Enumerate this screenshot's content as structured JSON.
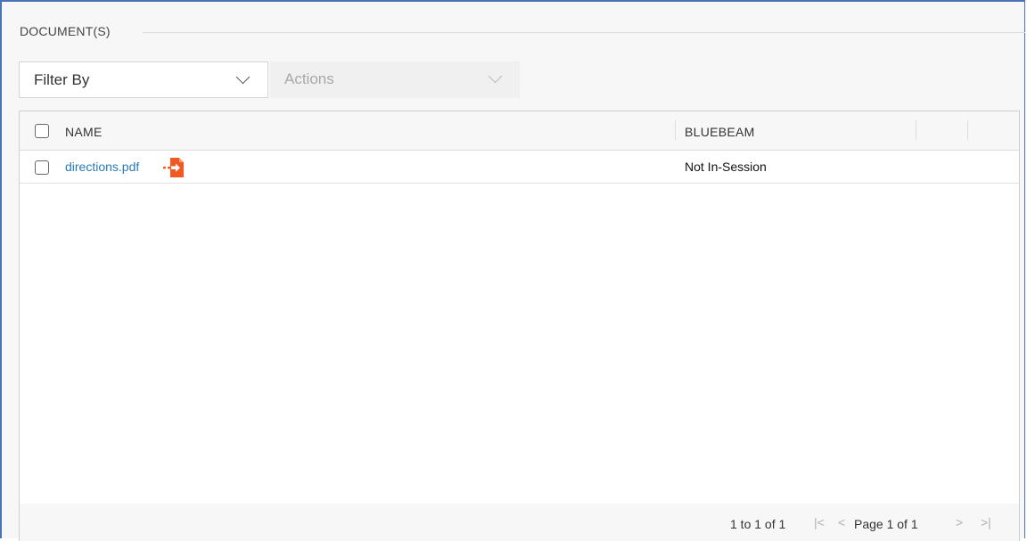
{
  "section": {
    "title": "DOCUMENT(S)"
  },
  "toolbar": {
    "filter_label": "Filter By",
    "actions_label": "Actions"
  },
  "grid": {
    "columns": {
      "name": "NAME",
      "bluebeam": "BLUEBEAM"
    },
    "rows": [
      {
        "name": "directions.pdf",
        "bluebeam": "Not In-Session",
        "icon": "pdf-export-icon"
      }
    ]
  },
  "pagination": {
    "range": "1 to 1 of 1",
    "first_glyph": "|<",
    "prev_glyph": "<",
    "page": "Page 1 of 1",
    "next_glyph": ">",
    "last_glyph": ">|"
  },
  "colors": {
    "accent_border": "#4a73b5",
    "link": "#2a7ab8",
    "pdf_icon": "#f05a22"
  }
}
